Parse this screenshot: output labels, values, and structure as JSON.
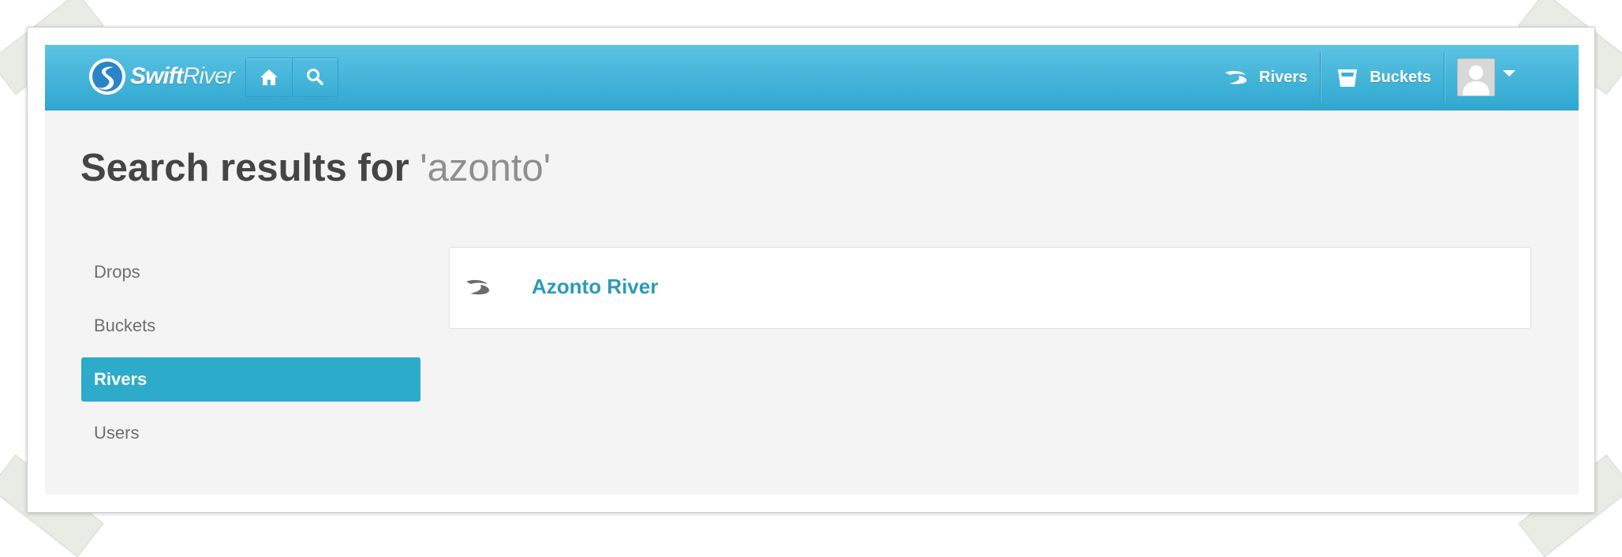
{
  "header": {
    "logo": "SwiftRiver",
    "nav_icons": [
      "home-icon",
      "search-icon"
    ],
    "links": [
      {
        "label": "Rivers",
        "icon": "river-icon"
      },
      {
        "label": "Buckets",
        "icon": "bucket-icon"
      }
    ],
    "user_menu_icon": "avatar"
  },
  "page": {
    "title_prefix": "Search results for",
    "query": "'azonto'"
  },
  "sidebar": {
    "items": [
      {
        "label": "Drops",
        "active": false
      },
      {
        "label": "Buckets",
        "active": false
      },
      {
        "label": "Rivers",
        "active": true
      },
      {
        "label": "Users",
        "active": false
      }
    ]
  },
  "results": [
    {
      "label": "Azonto River",
      "icon": "river-icon"
    }
  ],
  "colors": {
    "header_top": "#5cc3e3",
    "header_bottom": "#2fa8d0",
    "active_tab": "#2dabca",
    "link": "#2d9ab9"
  }
}
